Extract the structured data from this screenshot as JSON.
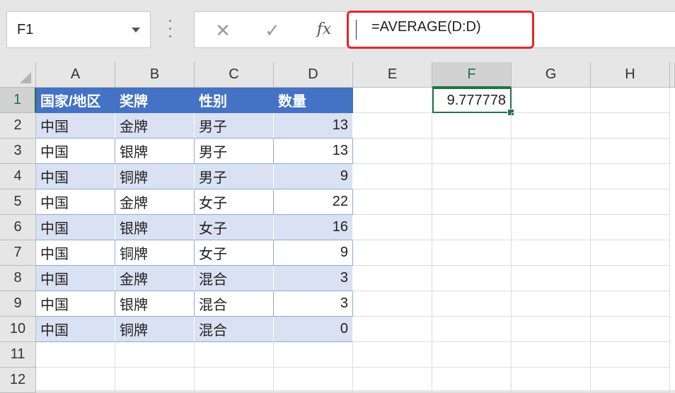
{
  "name_box": {
    "value": "F1"
  },
  "formula_bar": {
    "formula": "=AVERAGE(D:D)",
    "fx_label": "fx"
  },
  "colors": {
    "header_fill": "#4472c4",
    "band_fill": "#d9e1f2",
    "selection": "#217346",
    "highlight_box": "#e6262b"
  },
  "sheet": {
    "columns": [
      "A",
      "B",
      "C",
      "D",
      "E",
      "F",
      "G",
      "H"
    ],
    "rows": [
      "1",
      "2",
      "3",
      "4",
      "5",
      "6",
      "7",
      "8",
      "9",
      "10",
      "11",
      "12"
    ],
    "table": {
      "header": [
        "国家/地区",
        "奖牌",
        "性别",
        "数量"
      ],
      "rows": [
        [
          "中国",
          "金牌",
          "男子",
          "13"
        ],
        [
          "中国",
          "银牌",
          "男子",
          "13"
        ],
        [
          "中国",
          "铜牌",
          "男子",
          "9"
        ],
        [
          "中国",
          "金牌",
          "女子",
          "22"
        ],
        [
          "中国",
          "银牌",
          "女子",
          "16"
        ],
        [
          "中国",
          "铜牌",
          "女子",
          "9"
        ],
        [
          "中国",
          "金牌",
          "混合",
          "3"
        ],
        [
          "中国",
          "银牌",
          "混合",
          "3"
        ],
        [
          "中国",
          "铜牌",
          "混合",
          "0"
        ]
      ]
    },
    "active_cell": {
      "ref": "F1",
      "value": "9.777778"
    }
  }
}
